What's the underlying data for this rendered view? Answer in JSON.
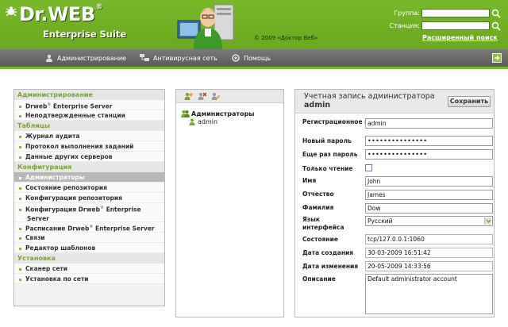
{
  "header": {
    "logo_text": "Dr.WEB",
    "logo_sub": "Enterprise Suite",
    "copyright": "© 2009 «Доктор Веб»",
    "group_label": "Группа:",
    "group_value": "",
    "station_label": "Станция:",
    "station_value": "",
    "advanced_search": "Расширенный поиск",
    "brand_color": "#72b026"
  },
  "nav": {
    "items": [
      {
        "label": "Администрирование",
        "icon": "admin-icon"
      },
      {
        "label": "Антивирусная сеть",
        "icon": "network-icon"
      },
      {
        "label": "Помощь",
        "icon": "help-icon"
      }
    ],
    "exit_icon": "exit-icon"
  },
  "sidebar": {
    "sections": [
      {
        "title": "Администрирование",
        "items": [
          {
            "label": "Drweb",
            "sup": "®",
            "label2": " Enterprise Server"
          },
          {
            "label": "Неподтвержденные станции"
          }
        ]
      },
      {
        "title": "Таблицы",
        "items": [
          {
            "label": "Журнал аудита"
          },
          {
            "label": "Протокол выполнения заданий"
          },
          {
            "label": "Данные других серверов"
          }
        ]
      },
      {
        "title": "Конфигурация",
        "items": [
          {
            "label": "Администраторы",
            "active": true
          },
          {
            "label": "Состояние репозитория"
          },
          {
            "label": "Конфигурация репозитория"
          },
          {
            "label": "Конфигурация Drweb",
            "sup": "®",
            "label2": " Enterprise Server"
          },
          {
            "label": "Расписание Drweb",
            "sup": "®",
            "label2": " Enterprise Server"
          },
          {
            "label": "Связи"
          },
          {
            "label": "Редактор шаблонов"
          }
        ]
      },
      {
        "title": "Установка",
        "items": [
          {
            "label": "Сканер сети"
          },
          {
            "label": "Установка по сети"
          }
        ]
      }
    ]
  },
  "tree": {
    "toolbar_icons": [
      "add-user-icon",
      "delete-user-icon",
      "edit-icon"
    ],
    "root": "Администраторы",
    "child": "admin"
  },
  "account": {
    "title": "Учетная запись администратора",
    "title_bold": "admin",
    "save_label": "Сохранить",
    "fields": {
      "login_label": "Регистрационное имя",
      "login_value": "admin",
      "password_label": "Новый пароль",
      "password_value": "•••••••••••••••",
      "password2_label": "Еще раз пароль",
      "password2_value": "•••••••••••••••",
      "readonly_label": "Только чтение",
      "readonly_checked": false,
      "name_label": "Имя",
      "name_value": "John",
      "patronymic_label": "Отчество",
      "patronymic_value": "James",
      "surname_label": "Фамилия",
      "surname_value": "Dow",
      "language_label": "Язык интерфейса",
      "language_value": "Русский",
      "state_label": "Состояние",
      "state_value": "tcp/127.0.0.1:1060",
      "created_label": "Дата создания",
      "created_value": "30-03-2009 16:51:42",
      "modified_label": "Дата изменения",
      "modified_value": "20-05-2009 14:33:56",
      "description_label": "Описание",
      "description_value": "Default administrator account"
    }
  }
}
